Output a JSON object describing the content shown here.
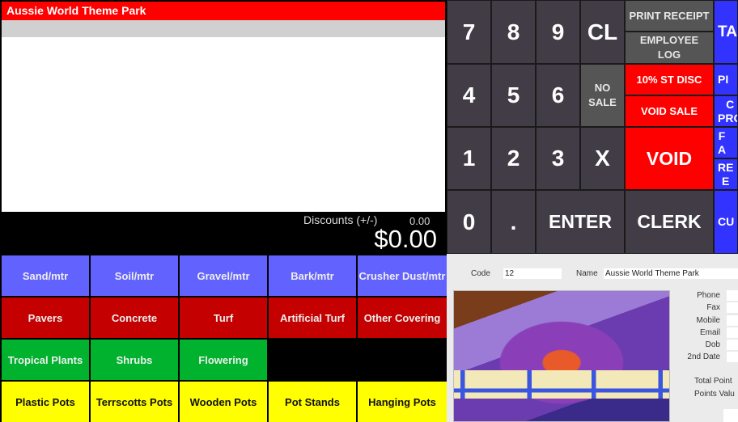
{
  "transaction": {
    "title": "Aussie World Theme Park",
    "discounts_label": "Discounts (+/-)",
    "discounts_value": "0.00",
    "total": "$0.00"
  },
  "keypad": {
    "digits": [
      "7",
      "8",
      "9",
      "4",
      "5",
      "6",
      "1",
      "2",
      "3",
      "0",
      "."
    ],
    "clear": "CL",
    "no_sale": "NO SALE",
    "multiply": "X",
    "enter": "ENTER",
    "print_receipt": "PRINT RECEIPT",
    "employee_log": "EMPLOYEE LOG",
    "discount_10": "10% ST DISC",
    "void_sale": "VOID SALE",
    "void": "VOID",
    "clerk": "CLERK",
    "side_buttons": [
      "TA",
      "PI",
      "C\nPRO",
      "F\nA",
      "RE\nE",
      "CU"
    ]
  },
  "categories": [
    {
      "label": "Sand/mtr",
      "color": "blue"
    },
    {
      "label": "Soil/mtr",
      "color": "blue"
    },
    {
      "label": "Gravel/mtr",
      "color": "blue"
    },
    {
      "label": "Bark/mtr",
      "color": "blue"
    },
    {
      "label": "Crusher Dust/mtr",
      "color": "blue"
    },
    {
      "label": "Pavers",
      "color": "red"
    },
    {
      "label": "Concrete",
      "color": "red"
    },
    {
      "label": "Turf",
      "color": "red"
    },
    {
      "label": "Artificial Turf",
      "color": "red"
    },
    {
      "label": "Other Covering",
      "color": "red"
    },
    {
      "label": "Tropical Plants",
      "color": "green"
    },
    {
      "label": "Shrubs",
      "color": "green"
    },
    {
      "label": "Flowering",
      "color": "green"
    },
    {
      "label": "Plastic Pots",
      "color": "yellow"
    },
    {
      "label": "Terrscotts Pots",
      "color": "yellow"
    },
    {
      "label": "Wooden Pots",
      "color": "yellow"
    },
    {
      "label": "Pot Stands",
      "color": "yellow"
    },
    {
      "label": "Hanging Pots",
      "color": "yellow"
    }
  ],
  "customer": {
    "code_label": "Code",
    "code_value": "12",
    "name_label": "Name",
    "name_value": "Aussie World Theme Park",
    "phone_label": "Phone",
    "fax_label": "Fax",
    "mobile_label": "Mobile",
    "email_label": "Email",
    "dob_label": "Dob",
    "second_date_label": "2nd Date",
    "total_points_label": "Total Point",
    "points_value_label": "Points Valu"
  },
  "colors": {
    "title_red": "#ff0000",
    "key_dark": "#413c46",
    "key_blue": "#3333ff",
    "cat_blue": "#6262ff",
    "cat_red": "#c40000",
    "cat_green": "#00b22e",
    "cat_yellow": "#ffff00"
  }
}
